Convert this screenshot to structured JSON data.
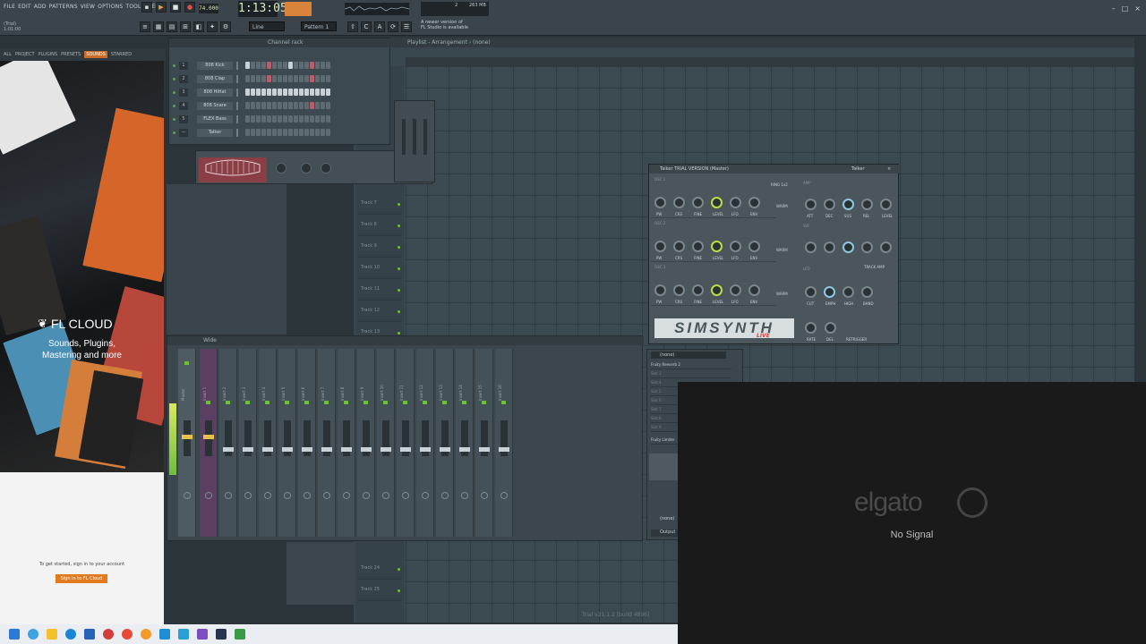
{
  "menu": [
    "FILE",
    "EDIT",
    "ADD",
    "PATTERNS",
    "VIEW",
    "OPTIONS",
    "TOOLS",
    "HELP"
  ],
  "transport": {
    "bpm": "74.000",
    "time": "1:13:05",
    "pattern": "Pattern 1",
    "mode": "Line"
  },
  "hint": {
    "line1": "A newer version of",
    "line2": "FL Studio is available"
  },
  "cpu": {
    "value1": "2",
    "value2": "263 MB"
  },
  "song_pos": {
    "line1": "(Trial)",
    "line2": "1:01:00"
  },
  "browser": {
    "tabs": [
      "ALL",
      "PROJECT",
      "PLUGINS",
      "PRESETS",
      "SOUNDS",
      "STARRED"
    ],
    "active_tab": "SOUNDS",
    "promo_title": "FL CLOUD",
    "promo_tagline_1": "Sounds, Plugins,",
    "promo_tagline_2": "Mastering and more",
    "signin_text": "To get started, sign in to your account",
    "signin_button": "Sign in to FL Cloud"
  },
  "channel_rack": {
    "title": "Channel rack",
    "channels": [
      {
        "num": "1",
        "name": "808 Kick"
      },
      {
        "num": "2",
        "name": "808 Clap"
      },
      {
        "num": "3",
        "name": "808 HiHat"
      },
      {
        "num": "4",
        "name": "808 Snare"
      },
      {
        "num": "5",
        "name": "FLEX Bass"
      },
      {
        "num": "—",
        "name": "Talker"
      }
    ]
  },
  "playlist": {
    "title": "Playlist - Arrangement › (none)",
    "tracks": [
      "Track 7",
      "Track 8",
      "Track 9",
      "Track 10",
      "Track 11",
      "Track 12",
      "Track 13",
      "Track 24",
      "Track 25"
    ]
  },
  "mixer": {
    "title": "Wide",
    "master": "Master",
    "inserts": [
      "Insert 1",
      "Insert 2",
      "Insert 3",
      "Insert 4",
      "Insert 5",
      "Insert 6",
      "Insert 7",
      "Insert 8",
      "Insert 9",
      "Insert 10",
      "Insert 11",
      "Insert 12",
      "Insert 13",
      "Insert 14",
      "Insert 15",
      "Insert 16"
    ]
  },
  "insert_panel": {
    "preset": "(none)",
    "first_slot": "Fruity Reeverb 2",
    "slots": [
      "Slot 3",
      "Slot 4",
      "Slot 5",
      "Slot 6",
      "Slot 7",
      "Slot 8",
      "Slot 9"
    ],
    "limiter": "Fruity Limiter",
    "bottom_preset": "(none)",
    "output": "Output"
  },
  "simsynth": {
    "title": "Talker TRIAL VERSION (Master)",
    "title_right": "Talker",
    "logo": "SIMSYNTH",
    "live": "LIVE",
    "osc_labels": [
      "OSC 1",
      "OSC 2",
      "OSC 3"
    ],
    "knob_labels": [
      "PW",
      "CRS",
      "FINE",
      "LEVEL",
      "LFO",
      "ENV"
    ],
    "right_labels": [
      "ATT",
      "DEC",
      "SUS",
      "REL",
      "LEVEL"
    ],
    "sections": [
      "AMP",
      "SVF",
      "LFO"
    ],
    "misc": [
      "RING 1x2",
      "WARM",
      "TRACK AMP",
      "CUT",
      "EMPH",
      "HIGH",
      "BAND",
      "RATE",
      "DEL",
      "RETRIGGER"
    ]
  },
  "elgato": {
    "logo": "elgato",
    "message": "No Signal"
  },
  "version": "Trial v21.1.2 [build 4896]",
  "colors": {
    "accent": "#c96e2a",
    "grid": "#3b4a51",
    "led": "#6fbf3e"
  }
}
